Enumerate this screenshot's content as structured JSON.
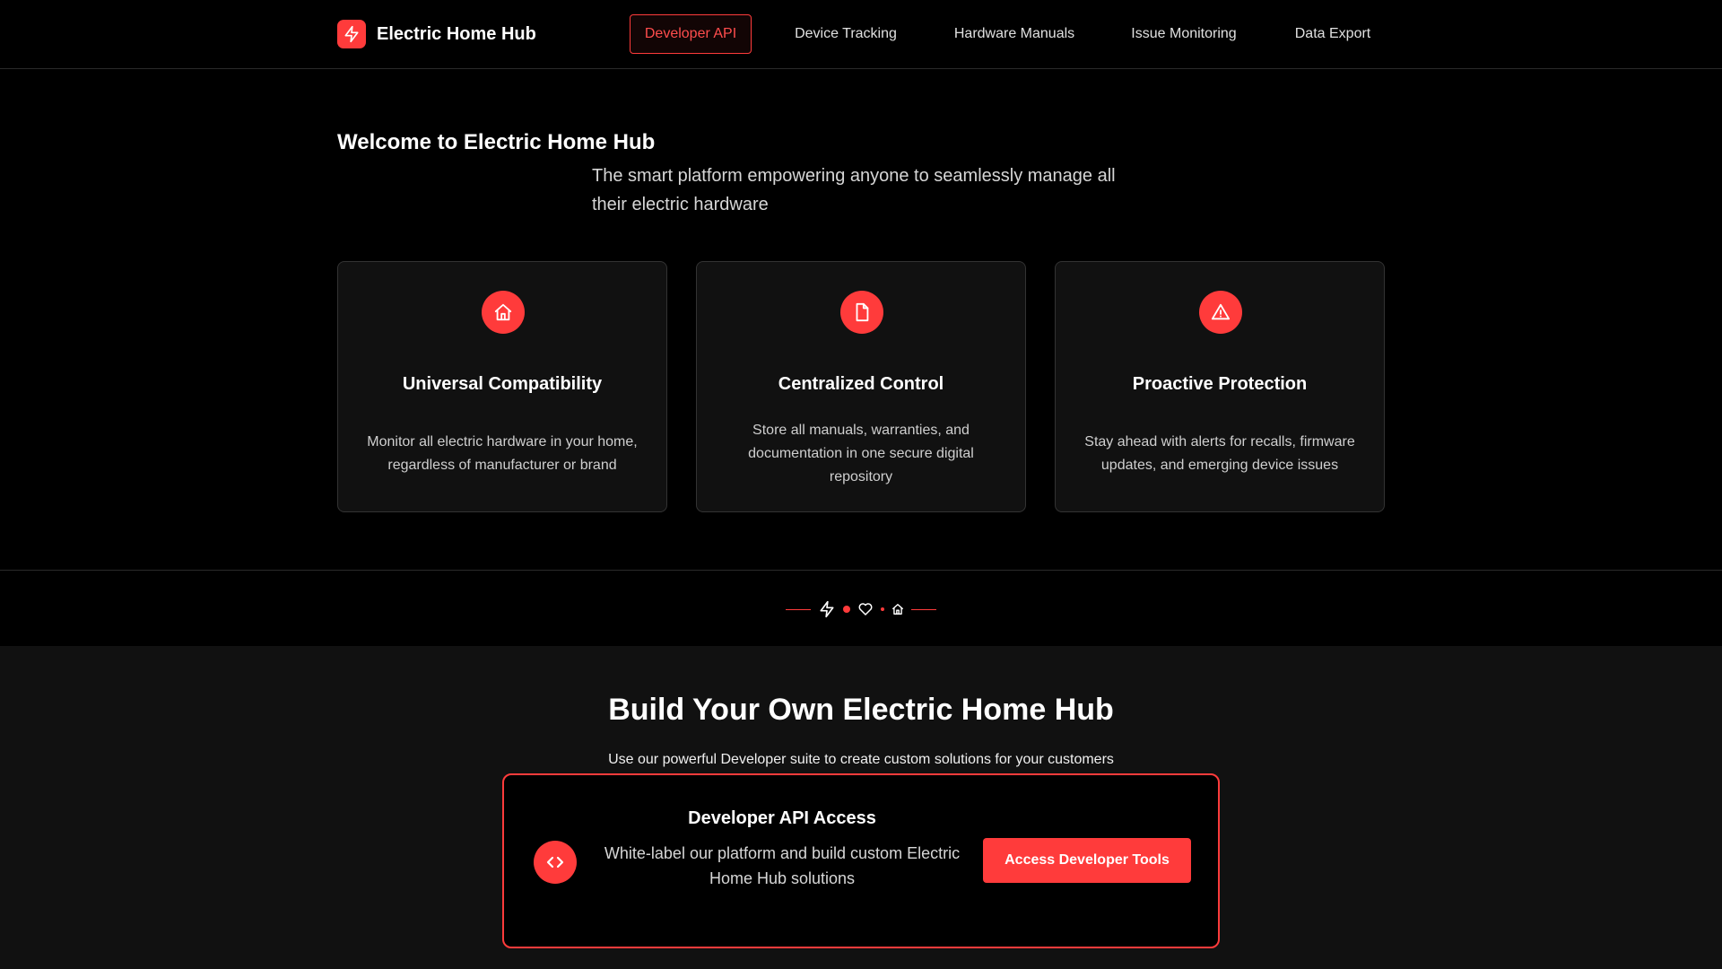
{
  "brand": {
    "name": "Electric Home Hub",
    "logo_icon": "lightning-bolt-icon"
  },
  "nav": {
    "items": [
      {
        "label": "Developer API",
        "active": true
      },
      {
        "label": "Device Tracking",
        "active": false
      },
      {
        "label": "Hardware Manuals",
        "active": false
      },
      {
        "label": "Issue Monitoring",
        "active": false
      },
      {
        "label": "Data Export",
        "active": false
      }
    ]
  },
  "hero": {
    "title": "Welcome to Electric Home Hub",
    "subtitle": "The smart platform empowering anyone to seamlessly manage all their electric hardware"
  },
  "features": [
    {
      "icon": "home-icon",
      "title": "Universal Compatibility",
      "description": "Monitor all electric hardware in your home, regardless of manufacturer or brand"
    },
    {
      "icon": "document-icon",
      "title": "Centralized Control",
      "description": "Store all manuals, warranties, and documentation in one secure digital repository"
    },
    {
      "icon": "warning-icon",
      "title": "Proactive Protection",
      "description": "Stay ahead with alerts for recalls, firmware updates, and emerging device issues"
    }
  ],
  "divider": {
    "icons": [
      "lightning-bolt-icon",
      "heart-icon",
      "home-icon"
    ]
  },
  "developer": {
    "title": "Build Your Own Electric Home Hub",
    "subtitle": "Use our powerful Developer suite to create custom solutions for your customers",
    "card": {
      "icon": "code-icon",
      "title": "Developer API Access",
      "description": "White-label our platform and build custom Electric Home Hub solutions",
      "button_label": "Access Developer Tools"
    }
  },
  "colors": {
    "accent": "#ff3b3b",
    "background": "#000000",
    "surface": "#111111",
    "text": "#ffffff",
    "muted_text": "#cfcfcf"
  }
}
